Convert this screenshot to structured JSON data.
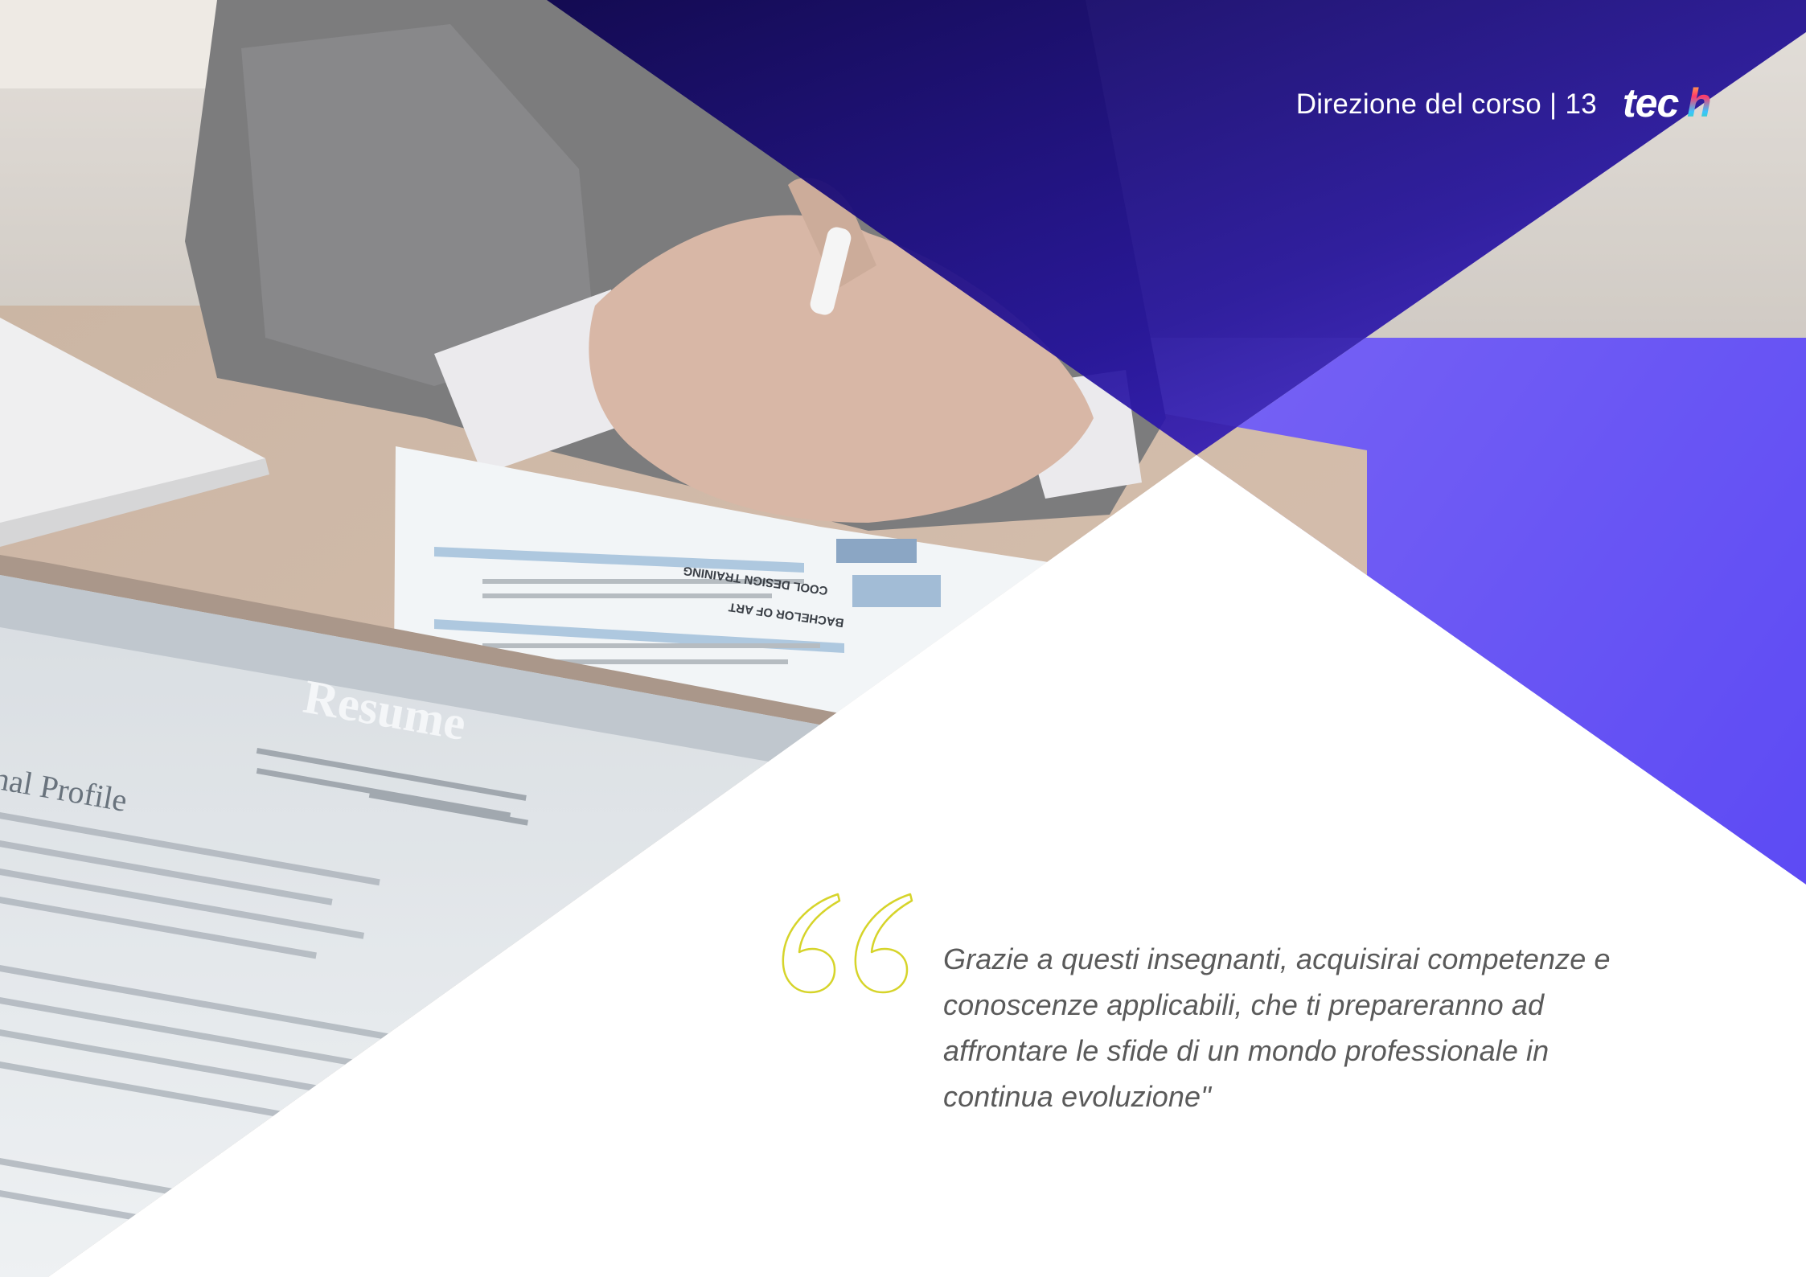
{
  "header": {
    "section_title": "Direzione del corso | 13",
    "logo_text": "tech"
  },
  "photo": {
    "description_icon": "resume-desk-photo",
    "resume_heading": "Resume",
    "resume_section": "nal Profile",
    "document_heading": "BACHELOR OF ART",
    "document_subheading": "COOL DESIGN TRAINING"
  },
  "quote": {
    "icon": "quote-open-icon",
    "text": "Grazie a questi insegnanti, acquisirai competenze e conoscenze applicabili, che ti prepareranno ad affrontare le sfide di un mondo professionale in continua evoluzione\""
  },
  "colors": {
    "brand_dark": "#150b5c",
    "brand_purple": "#3a1ae8",
    "brand_bright": "#2a0df5",
    "quote_mark": "#d6d42a",
    "quote_text": "#5a5a5a"
  }
}
